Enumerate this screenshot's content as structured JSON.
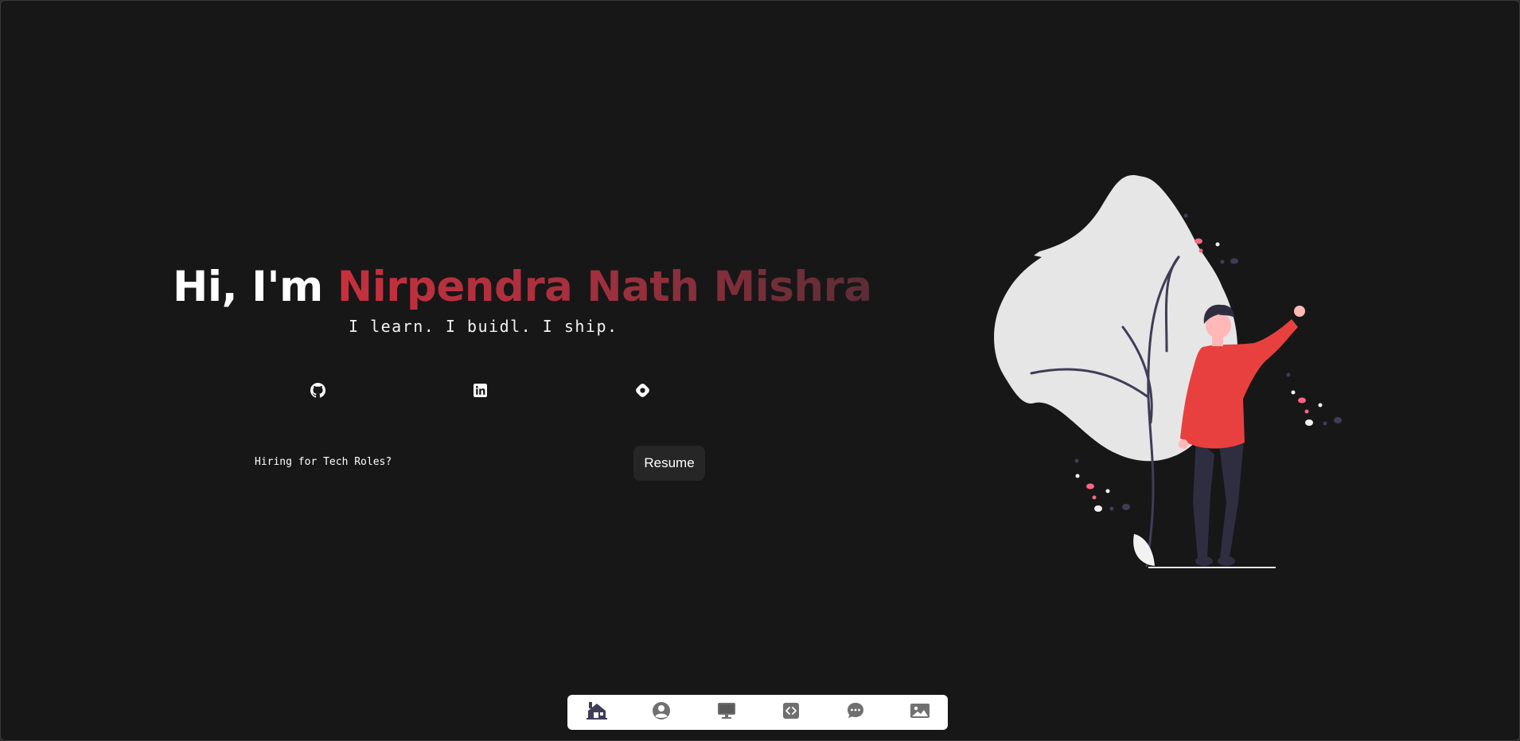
{
  "hero": {
    "greeting": "Hi, I'm ",
    "name": "Nirpendra Nath Mishra",
    "tagline": "I learn. I buidl. I ship."
  },
  "social_links": [
    {
      "icon": "github-icon",
      "label": "GitHub"
    },
    {
      "icon": "linkedin-icon",
      "label": "LinkedIn"
    },
    {
      "icon": "hashnode-icon",
      "label": "Hashnode"
    }
  ],
  "cta": {
    "hire_text": "Hiring for Tech Roles?",
    "resume_label": "Resume"
  },
  "nav": {
    "items": [
      {
        "icon": "home-icon",
        "label": "Home"
      },
      {
        "icon": "user-icon",
        "label": "About"
      },
      {
        "icon": "monitor-icon",
        "label": "Experience"
      },
      {
        "icon": "code-icon",
        "label": "Projects"
      },
      {
        "icon": "chat-icon",
        "label": "Contact"
      },
      {
        "icon": "image-icon",
        "label": "Gallery"
      }
    ]
  },
  "colors": {
    "background": "#171717",
    "accent_start": "#c7303d",
    "accent_end": "#5a2d37",
    "nav_icon": "#3f3d56",
    "sweater": "#e8403f",
    "leaf": "#e6e6e6"
  }
}
